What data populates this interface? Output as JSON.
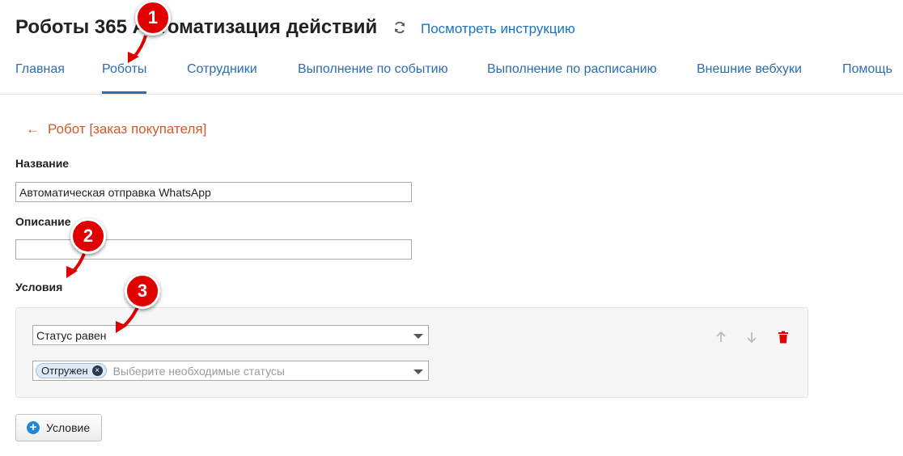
{
  "header": {
    "title": "Роботы 365 Автоматизация действий",
    "help_link": "Посмотреть инструкцию"
  },
  "tabs": [
    {
      "label": "Главная",
      "active": false
    },
    {
      "label": "Роботы",
      "active": true
    },
    {
      "label": "Сотрудники",
      "active": false
    },
    {
      "label": "Выполнение по событию",
      "active": false
    },
    {
      "label": "Выполнение по расписанию",
      "active": false
    },
    {
      "label": "Внешние вебхуки",
      "active": false
    },
    {
      "label": "Помощь",
      "active": false
    }
  ],
  "back": {
    "arrow": "←",
    "label": "Робот [заказ покупателя]"
  },
  "form": {
    "name_label": "Название",
    "name_value": "Автоматическая отправка WhatsApp",
    "description_label": "Описание",
    "description_value": "",
    "conditions_label": "Условия"
  },
  "condition": {
    "type_value": "Статус равен",
    "chip_label": "Отгружен",
    "chip_remove": "×",
    "status_placeholder": "Выберите необходимые статусы"
  },
  "add_condition": {
    "icon": "+",
    "label": "Условие"
  },
  "markers": [
    "1",
    "2",
    "3"
  ],
  "colors": {
    "tab_link": "#2a6db5",
    "back_link": "#d05a2a",
    "marker": "#e00000",
    "delete": "#e00000",
    "add_icon": "#1e88d6"
  },
  "icons": {
    "refresh": "refresh-icon",
    "move_up": "arrow-up-icon",
    "move_down": "arrow-down-icon",
    "delete": "trash-icon",
    "add": "plus-circle-icon"
  }
}
